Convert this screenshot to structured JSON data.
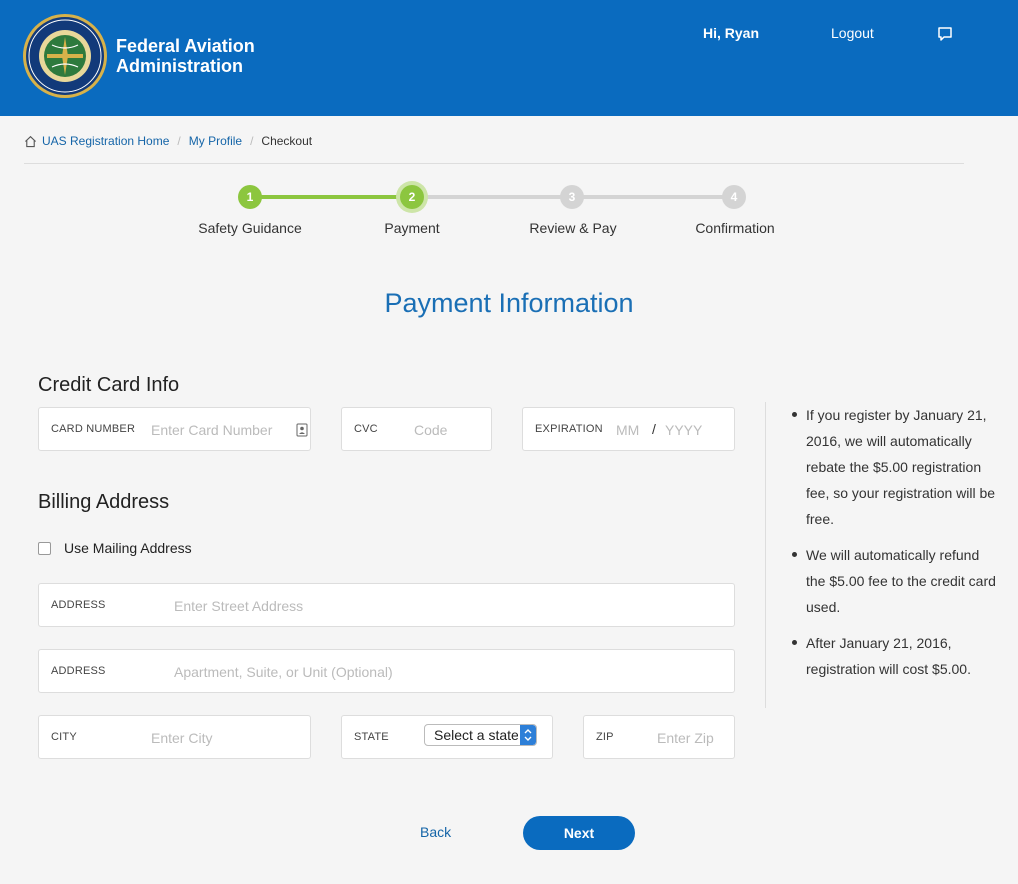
{
  "header": {
    "brand_line1": "Federal Aviation",
    "brand_line2": "Administration",
    "greeting": "Hi, Ryan",
    "logout": "Logout"
  },
  "breadcrumb": {
    "home": "UAS Registration Home",
    "profile": "My Profile",
    "current": "Checkout"
  },
  "steps": [
    {
      "number": "1",
      "label": "Safety Guidance",
      "status": "complete"
    },
    {
      "number": "2",
      "label": "Payment",
      "status": "current"
    },
    {
      "number": "3",
      "label": "Review & Pay",
      "status": "upcoming"
    },
    {
      "number": "4",
      "label": "Confirmation",
      "status": "upcoming"
    }
  ],
  "page_title": "Payment Information",
  "credit_card": {
    "section_title": "Credit Card Info",
    "card_number_label": "CARD NUMBER",
    "card_number_placeholder": "Enter Card Number",
    "cvc_label": "CVC",
    "cvc_placeholder": "Code",
    "expiration_label": "EXPIRATION",
    "month_placeholder": "MM",
    "separator": "/",
    "year_placeholder": "YYYY"
  },
  "billing": {
    "section_title": "Billing Address",
    "use_mailing_label": "Use Mailing Address",
    "address1_label": "ADDRESS",
    "address1_placeholder": "Enter Street Address",
    "address2_label": "ADDRESS",
    "address2_placeholder": "Apartment, Suite, or Unit (Optional)",
    "city_label": "CITY",
    "city_placeholder": "Enter City",
    "state_label": "STATE",
    "state_value": "Select a state",
    "zip_label": "ZIP",
    "zip_placeholder": "Enter Zip"
  },
  "sidebar_notes": [
    "If you register by January 21, 2016, we will automatically rebate the $5.00 registration fee, so your registration will be free.",
    "We will automatically refund the $5.00 fee to the credit card used.",
    "After January 21, 2016, registration will cost $5.00."
  ],
  "actions": {
    "back": "Back",
    "next": "Next"
  },
  "colors": {
    "header_blue": "#0a6bbf",
    "step_complete": "#8cc63f",
    "step_upcoming": "#d4d4d4",
    "title_blue": "#1a6fb5"
  }
}
